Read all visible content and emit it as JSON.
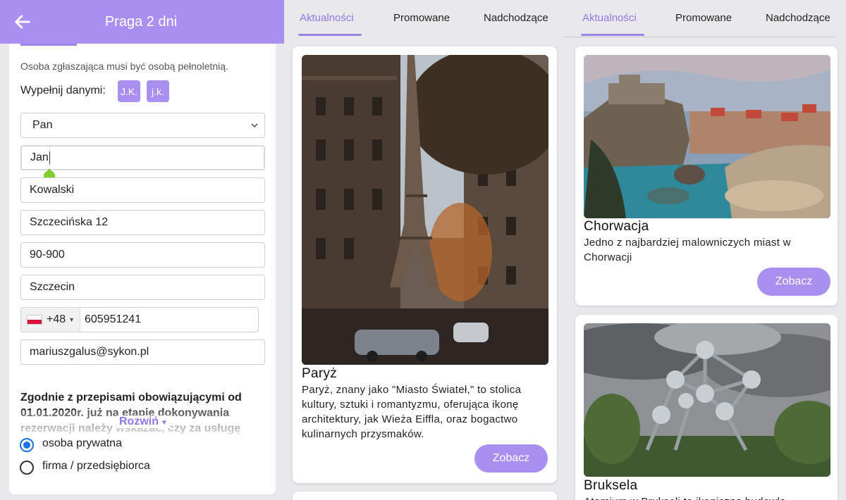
{
  "panel1": {
    "title": "Praga 2 dni",
    "note": "Osoba zgłaszająca musi być osobą pełnoletnią.",
    "fill_label": "Wypełnij danymi:",
    "chips": [
      "J.K.",
      "j.k."
    ],
    "fields": {
      "salutation": "Pan",
      "first_name": "Jan",
      "last_name": "Kowalski",
      "street": "Szczecińska 12",
      "postal_code": "90-900",
      "city": "Szczecin",
      "dial_code": "+48",
      "phone": "605951241",
      "email": "mariuszgalus@sykon.pl"
    },
    "law_text": "Zgodnie z przepisami obowiązującymi od 01.01.2020r. już na etapie dokonywania rezerwacji należy wskazać, czy za usługę",
    "expand_label": "Rozwiń",
    "radio_options": [
      "osoba prywatna",
      "firma / przedsiębiorca"
    ],
    "radio_selected": "osoba prywatna"
  },
  "panel2": {
    "tabs": [
      "Aktualności",
      "Promowane",
      "Nadchodzące"
    ],
    "active_tab": "Aktualności",
    "cards": [
      {
        "title": "Paryż",
        "desc_lines": [
          "Paryż, znany jako \"Miasto Świateł,\" to stolica",
          "kultury, sztuki i romantyzmu, oferująca ikonę",
          "architektury, jak Wieża Eiffla, oraz bogactwo",
          "kulinarnych przysmaków."
        ],
        "button": "Zobacz"
      }
    ]
  },
  "panel3": {
    "tabs": [
      "Aktualności",
      "Promowane",
      "Nadchodzące"
    ],
    "active_tab": "Aktualności",
    "cards": [
      {
        "title": "Chorwacja",
        "desc_lines": [
          "Jedno z najbardziej malowniczych miast w",
          "Chorwacji"
        ],
        "button": "Zobacz"
      },
      {
        "title": "Bruksela",
        "desc_lines": [
          "Atomium w Brukseli to ikoniczna budowla"
        ]
      }
    ]
  },
  "colors": {
    "accent": "#a98ff0",
    "accent_text": "#8f76e6",
    "background": "#e9e9ec",
    "radio_selected": "#1a73e8"
  },
  "icons": [
    "back-arrow-icon",
    "chevron-down-icon",
    "poland-flag-icon",
    "caret-down-icon"
  ]
}
